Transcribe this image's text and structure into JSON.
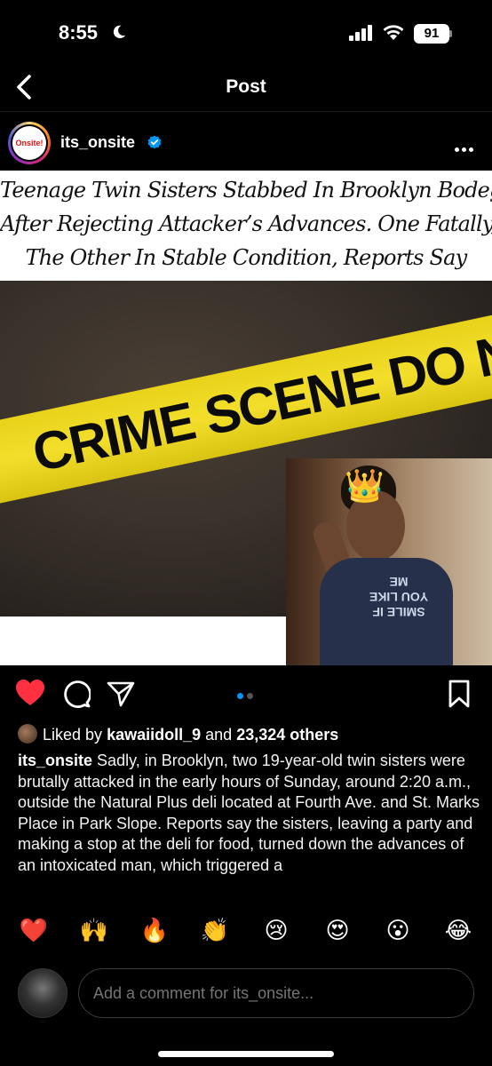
{
  "status_bar": {
    "time": "8:55",
    "battery": "91",
    "icons": [
      "moon-icon",
      "signal-icon",
      "wifi-icon",
      "battery-icon"
    ]
  },
  "nav": {
    "title": "Post",
    "back_icon": "chevron-left-icon"
  },
  "post": {
    "username": "its_onsite",
    "avatar_text": "Onsite!",
    "verified": true,
    "more_icon": "ellipsis-icon",
    "image": {
      "headline_lines": [
        "Teenage Twin Sisters Stabbed In Brooklyn Bodega",
        "After Rejecting Attacker’s Advances. One Fatally,",
        "The Other In Stable Condition, Reports Say"
      ],
      "tape_text": "CRIME SCENE DO NOT CROSS",
      "shirt_text": "SMILE IF YOU LIKE ME",
      "crown_emoji": "👑"
    },
    "carousel": {
      "count": 2,
      "active": 0
    },
    "colors": {
      "like": "#ff3040",
      "dot_active": "#0095f6",
      "dot_inactive": "#555555"
    },
    "likes": {
      "prefix": "Liked by",
      "user": "kawaiidoll_9",
      "joiner": "and",
      "others": "23,324 others"
    },
    "caption": {
      "username": "its_onsite",
      "text": "Sadly, in Brooklyn, two 19-year-old twin sisters were brutally attacked in the early hours of Sunday, around 2:20 a.m., outside the Natural Plus deli located at Fourth Ave. and St. Marks Place in Park Slope. Reports say the sisters, leaving a party and making a stop at the deli for food, turned down the advances of an intoxicated man, which triggered a"
    }
  },
  "reactions": [
    "❤️",
    "🙌",
    "🔥",
    "👏",
    "😢",
    "😍",
    "😮",
    "😂"
  ],
  "comment": {
    "placeholder": "Add a comment for its_onsite..."
  }
}
